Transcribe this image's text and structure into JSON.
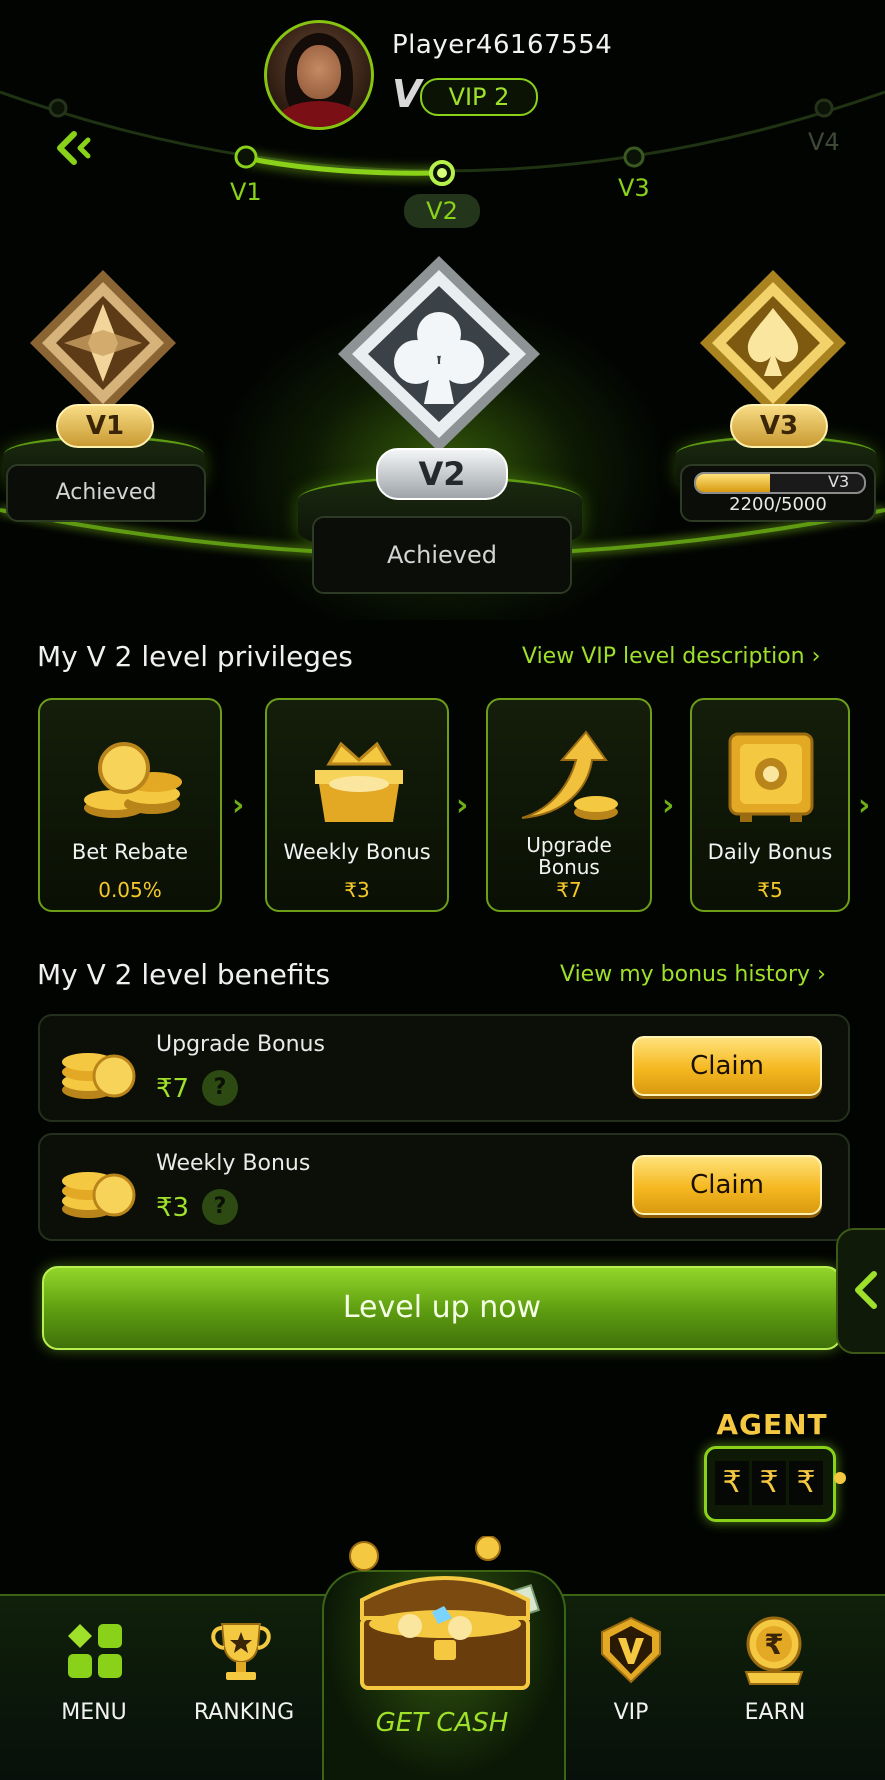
{
  "header": {
    "player_name": "Player46167554",
    "vip_badge_letter": "V",
    "vip_badge_label": "VIP 2"
  },
  "levels": {
    "track_labels": [
      "V1",
      "V2",
      "V3",
      "V4"
    ],
    "current": "V2"
  },
  "podiums": {
    "left": {
      "plate": "V1",
      "status": "Achieved"
    },
    "center": {
      "plate": "V2",
      "status": "Achieved"
    },
    "right": {
      "plate": "V3",
      "progress_tag": "V3",
      "progress_text": "2200/5000",
      "progress_fraction": 0.44
    }
  },
  "privileges": {
    "title": "My Ⅴ 2 level privileges",
    "link": "View VIP level description ›",
    "cards": [
      {
        "name": "Bet Rebate",
        "value": "0.05%"
      },
      {
        "name": "Weekly Bonus",
        "value": "₹3"
      },
      {
        "name_line1": "Upgrade",
        "name_line2": "Bonus",
        "value": "₹7"
      },
      {
        "name": "Daily Bonus",
        "value": "₹5"
      }
    ]
  },
  "benefits": {
    "title": "My Ⅴ 2 level benefits",
    "link": "View my bonus history ›",
    "rows": [
      {
        "name": "Upgrade Bonus",
        "value": "₹7",
        "help": "?",
        "button": "Claim"
      },
      {
        "name": "Weekly Bonus",
        "value": "₹3",
        "help": "?",
        "button": "Claim"
      }
    ]
  },
  "level_up_button": "Level up now",
  "agent": {
    "label": "AGENT",
    "reels": [
      "₹",
      "₹",
      "₹"
    ]
  },
  "nav": {
    "menu": "MENU",
    "ranking": "RANKING",
    "get_cash": "GET CASH",
    "vip": "VIP",
    "earn": "EARN"
  },
  "colors": {
    "accent_green": "#9fe02a",
    "gold": "#f5c82a",
    "background": "#020402"
  }
}
